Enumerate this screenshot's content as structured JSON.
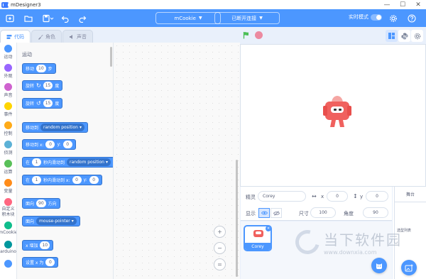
{
  "window": {
    "title": "mDesigner3",
    "controls": [
      "—",
      "☐",
      "✕"
    ]
  },
  "menubar": {
    "sprite_selector": "mCookie",
    "connection": "已断开连接",
    "realtime_label": "实时模式"
  },
  "tabs": [
    {
      "label": "代码",
      "active": true
    },
    {
      "label": "角色",
      "active": false
    },
    {
      "label": "声音",
      "active": false
    }
  ],
  "categories": [
    {
      "label": "运动",
      "color": "#4c97ff"
    },
    {
      "label": "外观",
      "color": "#9966ff"
    },
    {
      "label": "声音",
      "color": "#cf63cf"
    },
    {
      "label": "事件",
      "color": "#ffd500"
    },
    {
      "label": "控制",
      "color": "#ffab19"
    },
    {
      "label": "侦测",
      "color": "#5cb1d6"
    },
    {
      "label": "运算",
      "color": "#59c059"
    },
    {
      "label": "变量",
      "color": "#ff8c1a"
    },
    {
      "label": "自定义积木块",
      "color": "#ff6680"
    },
    {
      "label": "mCookie",
      "color": "#0fbd8c"
    },
    {
      "label": "arduino",
      "color": "#00979d"
    },
    {
      "label": "",
      "color": "#4c97ff"
    }
  ],
  "palette": {
    "heading": "运动",
    "move": {
      "pre": "移动",
      "value": "10",
      "post": "步"
    },
    "turn_right": {
      "pre": "旋转",
      "value": "15",
      "post": "度"
    },
    "turn_left": {
      "pre": "旋转",
      "value": "15",
      "post": "度"
    },
    "goto": {
      "pre": "移动到",
      "option": "random position"
    },
    "goto_xy": {
      "pre": "移动到 x:",
      "x": "0",
      "mid": "y:",
      "y": "0"
    },
    "glide": {
      "pre": "在",
      "value": "1",
      "mid": "秒内滑动到",
      "option": "random position"
    },
    "glide_xy": {
      "pre": "在",
      "value": "1",
      "mid": "秒内滑动到 x:",
      "x": "0",
      "ymid": "y:",
      "y": "0"
    },
    "point_dir": {
      "pre": "面向",
      "value": "90",
      "post": "方向"
    },
    "point_towards": {
      "pre": "面向",
      "option": "mouse-pointer"
    },
    "change_x": {
      "pre": "x 增加",
      "value": "10"
    },
    "set_x": {
      "pre": "设置 x 为",
      "value": "0"
    }
  },
  "zoom": {
    "in": "+",
    "out": "−",
    "reset": "="
  },
  "sprite_props": {
    "sprite_label": "精灵",
    "sprite_name": "Corey",
    "x_label": "x",
    "x": "0",
    "y_label": "y",
    "y": "0",
    "show_label": "显示",
    "size_label": "尺寸",
    "size": "100",
    "direction_label": "角度",
    "direction": "90"
  },
  "sprites": [
    {
      "name": "Corey",
      "selected": true
    }
  ],
  "stage_side": {
    "title": "舞台",
    "backdrops_label": "选型列表"
  },
  "watermark": {
    "main": "当下软件园",
    "sub": "www.downxia.com"
  },
  "colors": {
    "accent": "#4c97ff",
    "stage_bg": "#e9f0fb",
    "sprite_red": "#f0615e"
  }
}
